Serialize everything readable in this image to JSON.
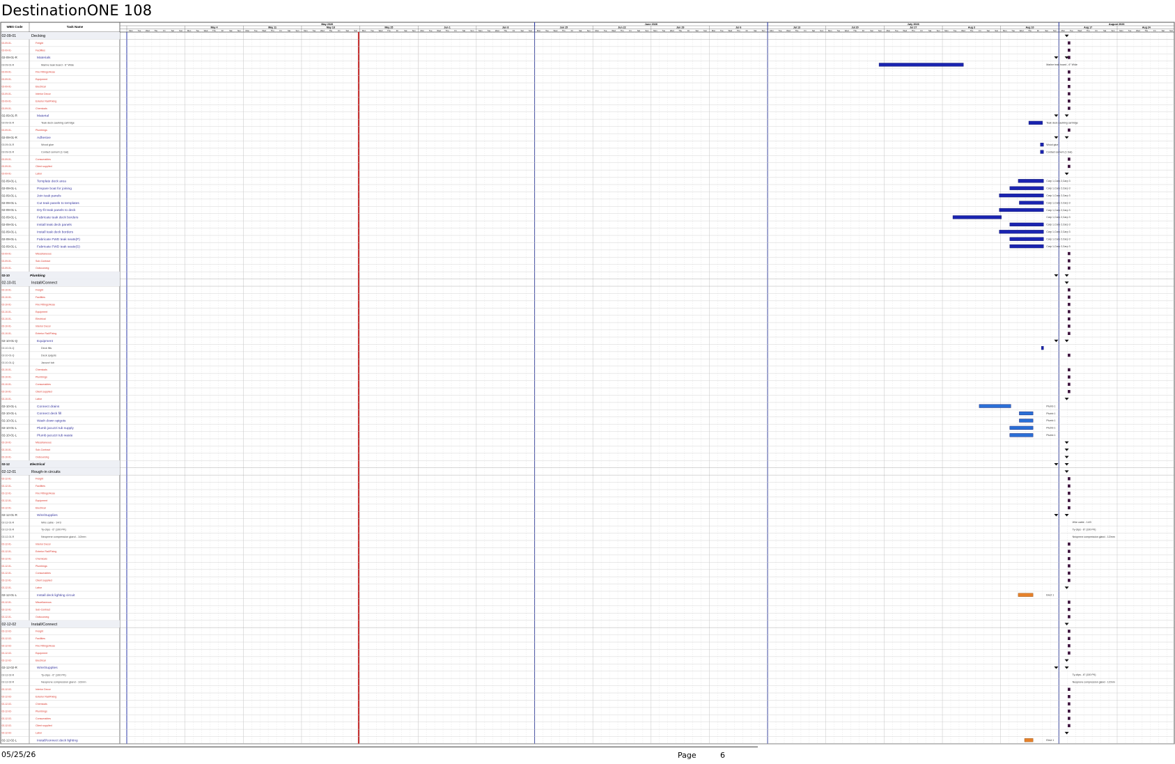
{
  "title": "DestinationONE 108",
  "footer": {
    "date": "05/25/26",
    "page_label": "Page",
    "page_number": "6"
  },
  "columns": {
    "wbs": "WBS Code",
    "task": "Task Name"
  },
  "months": [
    {
      "label": "May 2026",
      "from": 0,
      "to": 7
    },
    {
      "label": "June 2026",
      "from": 7,
      "to": 11
    },
    {
      "label": "July 2026",
      "from": 11,
      "to": 16
    },
    {
      "label": "August 2026",
      "from": 16,
      "to": 20
    }
  ],
  "weeks": [
    "",
    "May 4",
    "May 11",
    "May 18",
    "May 25",
    "Jun 1",
    "Jun 8",
    "Jun 15",
    "Jun 22",
    "Jun 29",
    "Jul 6",
    "Jul 13",
    "Jul 20",
    "Jul 27",
    "Aug 3",
    "Aug 10",
    "Aug 17",
    "Aug 24"
  ],
  "day_letters": [
    "Mon",
    "Tue",
    "Wed",
    "Thu",
    "Fri",
    "Sat",
    "Sun"
  ],
  "colors": {
    "bar_dark": "#1a24b0",
    "bar_light": "#2a6fd6",
    "bar_orange": "#e6812a",
    "milestone": "#3a0f3a",
    "today_line": "#c42a2a",
    "month_line": "#2b3aa8",
    "cat_red": "#d9362b",
    "task_blue": "#3a3aa0"
  },
  "rows": [
    {
      "wbs": "02-09-01",
      "name": "Decking",
      "kind": "group"
    },
    {
      "wbs": "02-09-01-",
      "name": "Freight",
      "kind": "cat",
      "m": 1
    },
    {
      "wbs": "02-09-01-",
      "name": "Facilities",
      "kind": "cat",
      "m": 1
    },
    {
      "wbs": "02-09-01-R",
      "name": "Materials",
      "kind": "sum",
      "m": 1
    },
    {
      "wbs": "02-09-01-R",
      "name": "Marine teak board - 6\" Wide",
      "kind": "sub",
      "bar": [
        0.72,
        0.8
      ],
      "style": "dark",
      "res": "Marine teak board - 6\" Wide"
    },
    {
      "wbs": "02-09-01-",
      "name": "Fire Fittings/Hose",
      "kind": "cat",
      "m": 1
    },
    {
      "wbs": "02-09-01-",
      "name": "Equipment",
      "kind": "cat",
      "m": 1
    },
    {
      "wbs": "02-09-01-",
      "name": "Electrical",
      "kind": "cat",
      "m": 1
    },
    {
      "wbs": "02-09-01-",
      "name": "Interior Decor",
      "kind": "cat",
      "m": 1
    },
    {
      "wbs": "02-09-01-",
      "name": "Exterior Rail/Fixing",
      "kind": "cat",
      "m": 1
    },
    {
      "wbs": "02-09-01-",
      "name": "Chemicals",
      "kind": "cat",
      "m": 1
    },
    {
      "wbs": "02-09-01-R",
      "name": "Material",
      "kind": "sum"
    },
    {
      "wbs": "02-09-01-R",
      "name": "Teak deck caulking cartridge",
      "kind": "sub",
      "bar": [
        0.862,
        0.875
      ],
      "style": "dark",
      "res": "Teak deck caulking cartridge"
    },
    {
      "wbs": "02-09-01-",
      "name": "Plumbings",
      "kind": "cat",
      "m": 1
    },
    {
      "wbs": "02-09-01-R",
      "name": "Adhesive",
      "kind": "sum"
    },
    {
      "wbs": "02-09-01-R",
      "name": "Wood glue",
      "kind": "sub",
      "bar": [
        0.873,
        0.876
      ],
      "style": "dark",
      "res": "Wood glue"
    },
    {
      "wbs": "02-09-01-R",
      "name": "Contact cement (1 Gal)",
      "kind": "sub",
      "bar": [
        0.873,
        0.876
      ],
      "style": "dark",
      "res": "Contact cement (1 Gal)"
    },
    {
      "wbs": "02-09-01-",
      "name": "Consumables",
      "kind": "cat",
      "m": 1
    },
    {
      "wbs": "02-09-01-",
      "name": "Client supplied",
      "kind": "cat",
      "m": 1
    },
    {
      "wbs": "02-09-01-",
      "name": "Labor",
      "kind": "cat"
    },
    {
      "wbs": "02-09-01-L",
      "name": "Template deck area",
      "kind": "task",
      "bar": [
        0.852,
        0.876
      ],
      "style": "dark",
      "res": "Carp 1,Carp 2,Carp 3"
    },
    {
      "wbs": "02-09-01-L",
      "name": "Prepare boat for joining",
      "kind": "task",
      "bar": [
        0.844,
        0.876
      ],
      "style": "dark",
      "res": "Carp 1,Carp 2,Carp 3"
    },
    {
      "wbs": "02-09-01-L",
      "name": "Join teak panels",
      "kind": "task",
      "bar": [
        0.834,
        0.876
      ],
      "style": "dark",
      "res": "Carp 1,Carp 2,Carp 3"
    },
    {
      "wbs": "02-09-01-L",
      "name": "Cut teak panels to templates",
      "kind": "task",
      "bar": [
        0.853,
        0.876
      ],
      "style": "dark",
      "res": "Carp 1,Carp 2,Carp 3"
    },
    {
      "wbs": "02-09-01-L",
      "name": "Dry-fit teak panels to deck",
      "kind": "task",
      "bar": [
        0.834,
        0.876
      ],
      "style": "dark",
      "res": "Carp 1,Carp 2,Carp 3"
    },
    {
      "wbs": "02-09-01-L",
      "name": "Fabricate teak deck borders",
      "kind": "task",
      "bar": [
        0.79,
        0.836
      ],
      "style": "dark",
      "res": "Carp 1,Carp 2,Carp 3"
    },
    {
      "wbs": "02-09-01-L",
      "name": "Install teak deck panels",
      "kind": "task",
      "bar": [
        0.844,
        0.876
      ],
      "style": "dark",
      "res": "Carp 1,Carp 2,Carp 3"
    },
    {
      "wbs": "02-09-01-L",
      "name": "Install teak deck borders",
      "kind": "task",
      "bar": [
        0.834,
        0.876
      ],
      "style": "dark",
      "res": "Carp 1,Carp 2,Carp 3"
    },
    {
      "wbs": "02-09-01-L",
      "name": "Fabricate FWD teak seats(P)",
      "kind": "task",
      "bar": [
        0.844,
        0.876
      ],
      "style": "dark",
      "res": "Carp 1,Carp 2,Carp 3"
    },
    {
      "wbs": "02-09-01-L",
      "name": "Fabricate FWD teak seats(S)",
      "kind": "task",
      "bar": [
        0.844,
        0.876
      ],
      "style": "dark",
      "res": "Carp 1,Carp 2,Carp 3"
    },
    {
      "wbs": "02-09-01-",
      "name": "Miscellaneous",
      "kind": "cat",
      "m": 1
    },
    {
      "wbs": "02-09-01-",
      "name": "Sub-Contract",
      "kind": "cat",
      "m": 1
    },
    {
      "wbs": "02-09-01-",
      "name": "Outsourcing",
      "kind": "cat",
      "m": 1
    },
    {
      "wbs": "02-10",
      "name": "Plumbing",
      "kind": "section"
    },
    {
      "wbs": "02-10-01",
      "name": "Install/Connect",
      "kind": "group"
    },
    {
      "wbs": "02-10-01-",
      "name": "Freight",
      "kind": "cat",
      "m": 1
    },
    {
      "wbs": "02-10-01-",
      "name": "Facilities",
      "kind": "cat",
      "m": 1
    },
    {
      "wbs": "02-10-01-",
      "name": "Fire Fittings/Hose",
      "kind": "cat",
      "m": 1
    },
    {
      "wbs": "02-10-01-",
      "name": "Equipment",
      "kind": "cat",
      "m": 1
    },
    {
      "wbs": "02-10-01-",
      "name": "Electrical",
      "kind": "cat",
      "m": 1
    },
    {
      "wbs": "02-10-01-",
      "name": "Interior Decor",
      "kind": "cat",
      "m": 1
    },
    {
      "wbs": "02-10-01-",
      "name": "Exterior Rail/Fixing",
      "kind": "cat",
      "m": 1
    },
    {
      "wbs": "02-10-01-Q",
      "name": "Equipment",
      "kind": "sum"
    },
    {
      "wbs": "02-10-01-Q",
      "name": "Deck fills",
      "kind": "sub",
      "bar": [
        0.874,
        0.876
      ],
      "style": "dark"
    },
    {
      "wbs": "02-10-01-Q",
      "name": "Deck spigots",
      "kind": "sub",
      "m": 1
    },
    {
      "wbs": "02-10-01-Q",
      "name": "Jacuzzi tub",
      "kind": "sub"
    },
    {
      "wbs": "02-10-01-",
      "name": "Chemicals",
      "kind": "cat",
      "m": 1
    },
    {
      "wbs": "02-10-01-",
      "name": "Plumbings",
      "kind": "cat",
      "m": 1
    },
    {
      "wbs": "02-10-01-",
      "name": "Consumables",
      "kind": "cat",
      "m": 1
    },
    {
      "wbs": "02-10-01-",
      "name": "Client supplied",
      "kind": "cat",
      "m": 1
    },
    {
      "wbs": "02-10-01-",
      "name": "Labor",
      "kind": "cat"
    },
    {
      "wbs": "02-10-01-L",
      "name": "Connect drains",
      "kind": "task",
      "bar": [
        0.815,
        0.845
      ],
      "style": "light",
      "res": "Plumb 1"
    },
    {
      "wbs": "02-10-01-L",
      "name": "Connect deck fill",
      "kind": "task",
      "bar": [
        0.853,
        0.866
      ],
      "style": "light",
      "res": "Plumb 1"
    },
    {
      "wbs": "02-10-01-L",
      "name": "Wash down spigots",
      "kind": "task",
      "bar": [
        0.853,
        0.866
      ],
      "style": "light",
      "res": "Plumb 1"
    },
    {
      "wbs": "02-10-01-L",
      "name": "Plumb jacuzzi tub supply",
      "kind": "task",
      "bar": [
        0.844,
        0.866
      ],
      "style": "light",
      "res": "Plumb 1"
    },
    {
      "wbs": "02-10-01-L",
      "name": "Plumb jacuzzi tub waste",
      "kind": "task",
      "bar": [
        0.844,
        0.866
      ],
      "style": "light",
      "res": "Plumb 1"
    },
    {
      "wbs": "02-10-01-",
      "name": "Miscellaneous",
      "kind": "cat"
    },
    {
      "wbs": "02-10-01-",
      "name": "Sub-Contract",
      "kind": "cat"
    },
    {
      "wbs": "02-10-01-",
      "name": "Outsourcing",
      "kind": "cat"
    },
    {
      "wbs": "02-12",
      "name": "Electrical",
      "kind": "section"
    },
    {
      "wbs": "02-12-01",
      "name": "Rough-in circuits",
      "kind": "group"
    },
    {
      "wbs": "02-12-01-",
      "name": "Freight",
      "kind": "cat",
      "m": 1
    },
    {
      "wbs": "02-12-01-",
      "name": "Facilities",
      "kind": "cat",
      "m": 1
    },
    {
      "wbs": "02-12-01-",
      "name": "Fire Fittings/Hose",
      "kind": "cat",
      "m": 1
    },
    {
      "wbs": "02-12-01-",
      "name": "Equipment",
      "kind": "cat",
      "m": 1
    },
    {
      "wbs": "02-12-01-",
      "name": "Electrical",
      "kind": "cat",
      "m": 1
    },
    {
      "wbs": "02-12-01-R",
      "name": "Wire/Supplies",
      "kind": "sum"
    },
    {
      "wbs": "02-12-01-R",
      "name": "Wire cable - 14/3",
      "kind": "sub",
      "res": "Wire cable - 14/3"
    },
    {
      "wbs": "02-12-01-R",
      "name": "Ty-clips - 6\" (100 PK)",
      "kind": "sub",
      "res": "Ty-clips - 6\" (100 PK)"
    },
    {
      "wbs": "02-12-01-R",
      "name": "Neoprene compression gland - 1/2mm",
      "kind": "sub",
      "res": "Neoprene compression gland - 1/2mm"
    },
    {
      "wbs": "02-12-01-",
      "name": "Interior Decor",
      "kind": "cat",
      "m": 1
    },
    {
      "wbs": "02-12-01-",
      "name": "Exterior Rail/Fixing",
      "kind": "cat",
      "m": 1
    },
    {
      "wbs": "02-12-01-",
      "name": "Chemicals",
      "kind": "cat",
      "m": 1
    },
    {
      "wbs": "02-12-01-",
      "name": "Plumbings",
      "kind": "cat",
      "m": 1
    },
    {
      "wbs": "02-12-01-",
      "name": "Consumables",
      "kind": "cat",
      "m": 1
    },
    {
      "wbs": "02-12-01-",
      "name": "Client supplied",
      "kind": "cat",
      "m": 1
    },
    {
      "wbs": "02-12-01-",
      "name": "Labor",
      "kind": "cat"
    },
    {
      "wbs": "02-12-01-L",
      "name": "Install deck lighting circuit",
      "kind": "task",
      "bar": [
        0.852,
        0.866
      ],
      "style": "orange",
      "res": "Elect 1"
    },
    {
      "wbs": "02-12-01-",
      "name": "Miscellaneous",
      "kind": "cat",
      "m": 1
    },
    {
      "wbs": "02-12-01-",
      "name": "Sub-Contract",
      "kind": "cat",
      "m": 1
    },
    {
      "wbs": "02-12-01-",
      "name": "Outsourcing",
      "kind": "cat",
      "m": 1
    },
    {
      "wbs": "02-12-02",
      "name": "Install/Connect",
      "kind": "group"
    },
    {
      "wbs": "02-12-02-",
      "name": "Freight",
      "kind": "cat",
      "m": 1
    },
    {
      "wbs": "02-12-02-",
      "name": "Facilities",
      "kind": "cat",
      "m": 1
    },
    {
      "wbs": "02-12-02-",
      "name": "Fire Fittings/Hose",
      "kind": "cat",
      "m": 1
    },
    {
      "wbs": "02-12-02-",
      "name": "Equipment",
      "kind": "cat",
      "m": 1
    },
    {
      "wbs": "02-12-02-",
      "name": "Electrical",
      "kind": "cat"
    },
    {
      "wbs": "02-12-02-R",
      "name": "Wire/Supplies",
      "kind": "sum"
    },
    {
      "wbs": "02-12-02-R",
      "name": "Ty-clips - 6\" (100 PK)",
      "kind": "sub",
      "res": "Ty-clips - 6\" (100 PK)"
    },
    {
      "wbs": "02-12-02-R",
      "name": "Neoprene compression gland - 1/2mm",
      "kind": "sub",
      "res": "Neoprene compression gland - 1/2mm"
    },
    {
      "wbs": "02-12-02-",
      "name": "Interior Decor",
      "kind": "cat",
      "m": 1
    },
    {
      "wbs": "02-12-02-",
      "name": "Exterior Rail/Fixing",
      "kind": "cat",
      "m": 1
    },
    {
      "wbs": "02-12-02-",
      "name": "Chemicals",
      "kind": "cat",
      "m": 1
    },
    {
      "wbs": "02-12-02-",
      "name": "Plumbings",
      "kind": "cat",
      "m": 1
    },
    {
      "wbs": "02-12-02-",
      "name": "Consumables",
      "kind": "cat",
      "m": 1
    },
    {
      "wbs": "02-12-02-",
      "name": "Client supplied",
      "kind": "cat",
      "m": 1
    },
    {
      "wbs": "02-12-02-",
      "name": "Labor",
      "kind": "cat"
    },
    {
      "wbs": "02-12-02-L",
      "name": "Install/connect deck lighting",
      "kind": "task",
      "bar": [
        0.858,
        0.866
      ],
      "style": "orange",
      "res": "Elect 1"
    }
  ]
}
